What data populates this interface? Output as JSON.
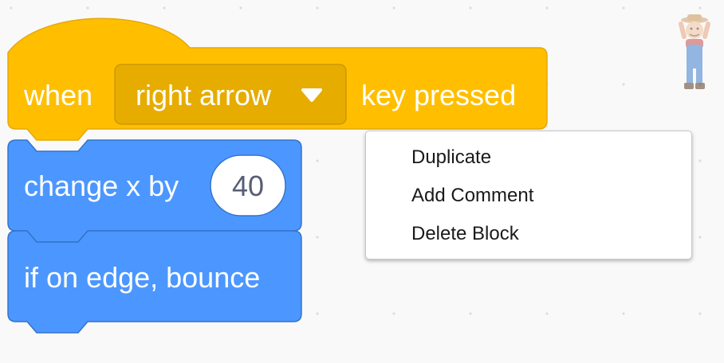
{
  "hat_block": {
    "prefix": "when",
    "key_dropdown": "right arrow",
    "suffix": "key pressed"
  },
  "motion_block": {
    "label": "change x by",
    "value": "40"
  },
  "bounce_block": {
    "label": "if on edge, bounce"
  },
  "context_menu": {
    "items": [
      "Duplicate",
      "Add Comment",
      "Delete Block"
    ]
  },
  "colors": {
    "events": "#ffbf00",
    "events_border": "#e6a808",
    "events_field": "#e6ac00",
    "motion": "#4c97ff",
    "motion_border": "#3373cc",
    "workspace_background": "#f9f9f9"
  },
  "icons": {
    "dropdown_arrow": "caret-down-icon",
    "sprite": "farmer-sprite-icon"
  }
}
